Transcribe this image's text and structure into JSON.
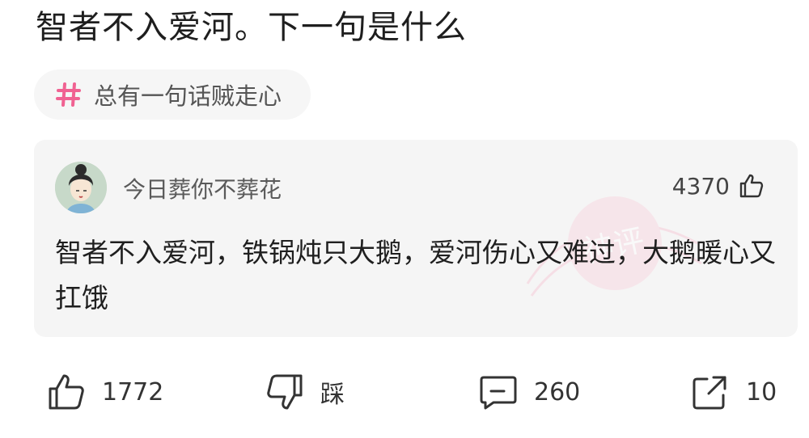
{
  "post": {
    "title": "智者不入爱河。下一句是什么",
    "topic": {
      "icon": "hash-icon",
      "label": "总有一句话贼走心",
      "icon_color": "#f06292"
    }
  },
  "comment": {
    "avatar": "avatar-illustration",
    "username": "今日葬你不葬花",
    "like_count": "4370",
    "text": "智者不入爱河，铁锅炖只大鹅，爱河伤心又难过，大鹅暖心又扛饿",
    "watermark_text": "神评"
  },
  "actions": {
    "like_count": "1772",
    "dislike_label": "踩",
    "comment_count": "260",
    "share_count": "10"
  },
  "colors": {
    "card_bg": "#f5f5f5",
    "chip_bg": "#f6f6f6",
    "accent": "#f06292"
  }
}
